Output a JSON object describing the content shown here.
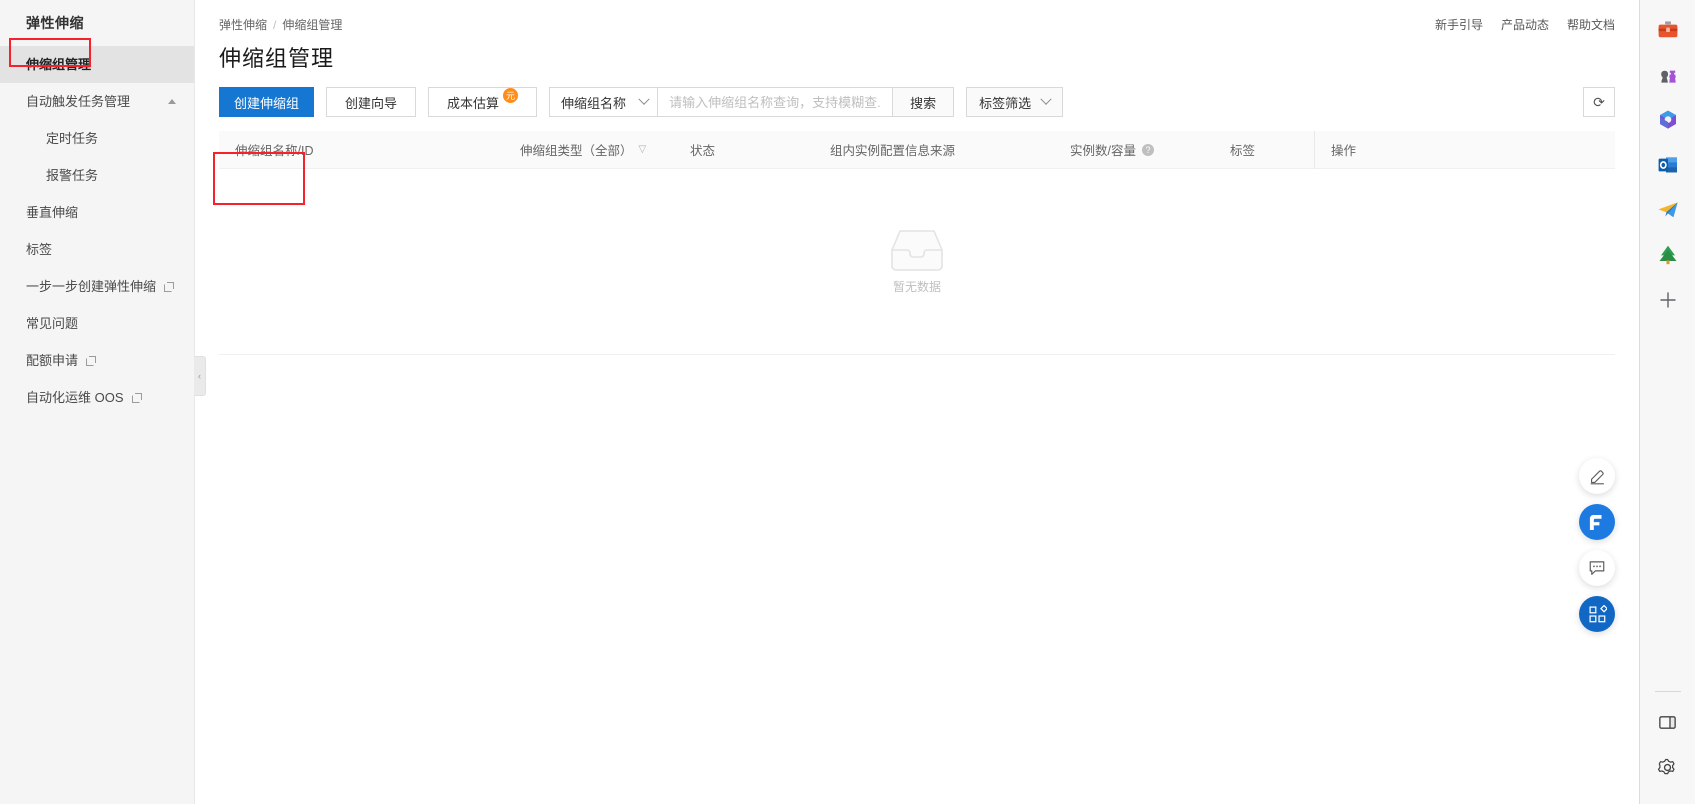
{
  "sidebar": {
    "title": "弹性伸缩",
    "items": [
      {
        "label": "伸缩组管理",
        "active": true,
        "type": "item"
      },
      {
        "label": "自动触发任务管理",
        "active": false,
        "type": "group",
        "expanded": true
      },
      {
        "label": "定时任务",
        "active": false,
        "type": "sub"
      },
      {
        "label": "报警任务",
        "active": false,
        "type": "sub"
      },
      {
        "label": "垂直伸缩",
        "active": false,
        "type": "item"
      },
      {
        "label": "标签",
        "active": false,
        "type": "item"
      },
      {
        "label": "一步一步创建弹性伸缩",
        "active": false,
        "type": "item",
        "external": true
      },
      {
        "label": "常见问题",
        "active": false,
        "type": "item"
      },
      {
        "label": "配额申请",
        "active": false,
        "type": "item",
        "external": true
      },
      {
        "label": "自动化运维 OOS",
        "active": false,
        "type": "item",
        "external": true
      }
    ],
    "collapse_handle_icon": "‹"
  },
  "breadcrumb": {
    "root": "弹性伸缩",
    "separator": "/",
    "current": "伸缩组管理"
  },
  "header_links": [
    "新手引导",
    "产品动态",
    "帮助文档"
  ],
  "page": {
    "title": "伸缩组管理"
  },
  "toolbar": {
    "create_label": "创建伸缩组",
    "wizard_label": "创建向导",
    "cost_label": "成本估算",
    "cost_badge": "元",
    "filter_field_label": "伸缩组名称",
    "search_placeholder": "请输入伸缩组名称查询，支持模糊查...",
    "search_value": "",
    "search_button_label": "搜索",
    "tag_filter_label": "标签筛选",
    "refresh_icon": "refresh-icon",
    "refresh_glyph": "⟳"
  },
  "table": {
    "columns": [
      {
        "key": "name_id",
        "label": "伸缩组名称/ID",
        "width_class": "c1"
      },
      {
        "key": "type",
        "label": "伸缩组类型（全部）",
        "width_class": "c2",
        "filterable": true
      },
      {
        "key": "status",
        "label": "状态",
        "width_class": "c3"
      },
      {
        "key": "config_source",
        "label": "组内实例配置信息来源",
        "width_class": "c4"
      },
      {
        "key": "instances",
        "label": "实例数/容量",
        "width_class": "c5",
        "help": true
      },
      {
        "key": "tags",
        "label": "标签",
        "width_class": "c6"
      },
      {
        "key": "actions",
        "label": "操作",
        "width_class": "c7"
      }
    ],
    "rows": [],
    "empty_text": "暂无数据"
  },
  "float_buttons": [
    {
      "name": "feedback-pen-button",
      "icon": "pen-icon"
    },
    {
      "name": "brand-f-button",
      "icon": "f-logo-icon"
    },
    {
      "name": "chat-button",
      "icon": "chat-bubble-icon"
    },
    {
      "name": "apps-button",
      "icon": "apps-grid-icon"
    }
  ],
  "edge_rail": {
    "icons": [
      {
        "name": "toolbox-icon",
        "glyph": "🧰"
      },
      {
        "name": "games-icon",
        "glyph": "♟"
      },
      {
        "name": "copilot-icon",
        "glyph": "◈"
      },
      {
        "name": "outlook-icon",
        "glyph": "O"
      },
      {
        "name": "telegram-icon",
        "glyph": "➤"
      },
      {
        "name": "tree-icon",
        "glyph": "🌲"
      },
      {
        "name": "add-icon",
        "glyph": "+"
      }
    ],
    "bottom_icons": [
      {
        "name": "split-screen-icon",
        "glyph": "▯"
      },
      {
        "name": "settings-gear-icon",
        "glyph": "⚙"
      }
    ]
  },
  "annotations": {
    "nav_box_color": "#f5222d",
    "create_box_color": "#f5222d"
  },
  "colors": {
    "primary": "#1677d2",
    "sidebar_bg": "#f5f5f5",
    "active_bg": "#e3e3e3",
    "badge_orange": "#ff8c17"
  }
}
